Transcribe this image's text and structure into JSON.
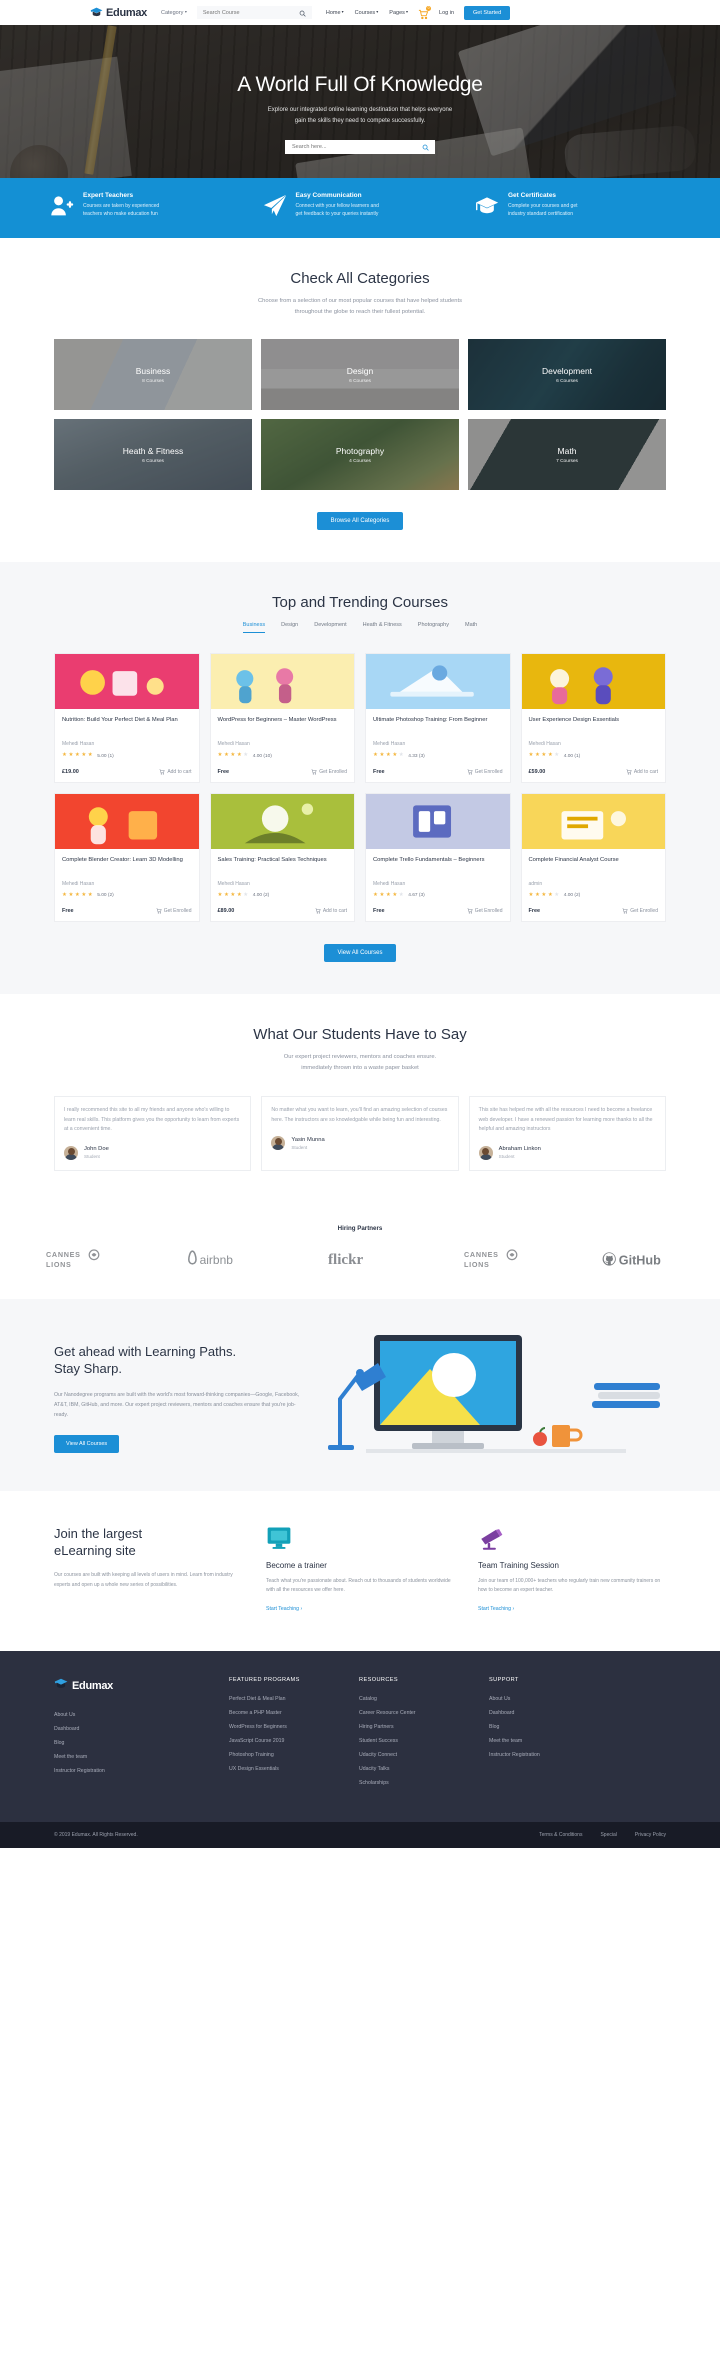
{
  "nav": {
    "brand": "Edumax",
    "category_label": "Category",
    "search_placeholder": "Search Course",
    "links": [
      {
        "label": "Home",
        "caret": true
      },
      {
        "label": "Courses",
        "caret": true
      },
      {
        "label": "Pages",
        "caret": true
      }
    ],
    "cart_count": "0",
    "login_label": "Log in",
    "cta_label": "Get Started"
  },
  "hero": {
    "title": "A World Full Of Knowledge",
    "subtitle_line1": "Explore our integrated online learning destination that helps everyone",
    "subtitle_line2": "gain the skills they need to compete successfully.",
    "search_placeholder": "Search here..."
  },
  "features": [
    {
      "icon": "user-plus-icon",
      "title": "Expert Teachers",
      "desc_line1": "Courses are taken by experienced",
      "desc_line2": "teachers who make education fun"
    },
    {
      "icon": "paper-plane-icon",
      "title": "Easy Communication",
      "desc_line1": "Connect with your fellow learners and",
      "desc_line2": "get feedback to your queries instantly"
    },
    {
      "icon": "graduation-cap-icon",
      "title": "Get Certificates",
      "desc_line1": "Complete your courses and get",
      "desc_line2": "industry standard certification"
    }
  ],
  "categories_section": {
    "title": "Check All Categories",
    "sub_line1": "Choose from a selection of our most popular courses that have helped students",
    "sub_line2": "throughout the globe to reach their fullest potential.",
    "button": "Browse All Categories",
    "items": [
      {
        "name": "Business",
        "count": "8 Courses",
        "img": "img-business"
      },
      {
        "name": "Design",
        "count": "6 Courses",
        "img": "img-design"
      },
      {
        "name": "Development",
        "count": "6 Courses",
        "img": "img-development"
      },
      {
        "name": "Heath & Fitness",
        "count": "6 Courses",
        "img": "img-fitness"
      },
      {
        "name": "Photography",
        "count": "4 Courses",
        "img": "img-photography"
      },
      {
        "name": "Math",
        "count": "7 Courses",
        "img": "img-math"
      }
    ]
  },
  "trending": {
    "title": "Top and Trending Courses",
    "tabs": [
      "Business",
      "Design",
      "Development",
      "Heath & Fitness",
      "Photography",
      "Math"
    ],
    "active_tab": "Business",
    "button": "View All Courses",
    "courses": [
      {
        "title": "Nutrition: Build Your Perfect Diet & Meal Plan",
        "author": "Mehedi Hasan",
        "stars": 5,
        "rating": "5.00",
        "reviews": "(1)",
        "price": "£19.00",
        "action": "Add to cart",
        "thumb": "#ea3d70"
      },
      {
        "title": "WordPress for Beginners – Master WordPress",
        "author": "Mehedi Hasan",
        "stars": 4,
        "rating": "4.00",
        "reviews": "(10)",
        "price": "Free",
        "action": "Get Enrolled",
        "thumb": "#fbeeb0"
      },
      {
        "title": "Ultimate Photoshop Training: From Beginner",
        "author": "Mehedi Hasan",
        "stars": 4,
        "rating": "4.33",
        "reviews": "(3)",
        "price": "Free",
        "action": "Get Enrolled",
        "thumb": "#a8d7f5"
      },
      {
        "title": "User Experience Design Essentials",
        "author": "Mehedi Hasan",
        "stars": 4,
        "rating": "4.00",
        "reviews": "(1)",
        "price": "£59.00",
        "action": "Add to cart",
        "thumb": "#e8b70e"
      },
      {
        "title": "Complete Blender Creator: Learn 3D Modelling",
        "author": "Mehedi Hasan",
        "stars": 5,
        "rating": "5.00",
        "reviews": "(2)",
        "price": "Free",
        "action": "Get Enrolled",
        "thumb": "#f2452f"
      },
      {
        "title": "Sales Training: Practical Sales Techniques",
        "author": "Mehedi Hasan",
        "stars": 4,
        "rating": "4.00",
        "reviews": "(2)",
        "price": "£89.00",
        "action": "Add to cart",
        "thumb": "#a9bf3c"
      },
      {
        "title": "Complete Trello Fundamentals – Beginners",
        "author": "Mehedi Hasan",
        "stars": 4,
        "rating": "4.67",
        "reviews": "(3)",
        "price": "Free",
        "action": "Get Enrolled",
        "thumb": "#c3c9e4"
      },
      {
        "title": "Complete Financial Analyst Course",
        "author": "admin",
        "stars": 4,
        "rating": "4.00",
        "reviews": "(2)",
        "price": "Free",
        "action": "Get Enrolled",
        "thumb": "#f8d659"
      }
    ]
  },
  "testimonials": {
    "title": "What Our Students Have to Say",
    "sub_line1": "Our expert project reviewers, mentors and coaches ensure.",
    "sub_line2": "immediately thrown into a waste paper basket",
    "items": [
      {
        "text": "I really recommend this site to all my friends and anyone who's willing to learn real skills. This platform gives you the opportunity to learn from experts at a convenient time.",
        "name": "John Doe",
        "role": "Student"
      },
      {
        "text": "No matter what you want to learn, you'll find an amazing selection of courses here. The instructors are so knowledgable while being fun and interesting.",
        "name": "Yasin Munna",
        "role": "Student"
      },
      {
        "text": "This site has helped me with all the resources I need to become a freelance web developer. I have a renewed passion for learning more thanks to all the helpful and amazing instructors",
        "name": "Abraham Linkon",
        "role": "Student"
      }
    ]
  },
  "partners": {
    "title": "Hiring Partners",
    "logos": [
      "CANNES LIONS",
      "airbnb",
      "flickr",
      "CANNES LIONS",
      "GitHub"
    ]
  },
  "learning_path": {
    "title_line1": "Get ahead with Learning Paths.",
    "title_line2": "Stay Sharp.",
    "text": "Our Nanodegree programs are built with the world's most forward-thinking companies—Google, Facebook, AT&T, IBM, GitHub, and more. Our expert project reviewers, mentors and coaches ensure that you're job-ready.",
    "button": "View All Courses"
  },
  "join": {
    "title_line1": "Join the largest",
    "title_line2": "eLearning site",
    "text": "Our courses are built with keeping all levels of users in mind. Learn from industry experts and open up a whole new series of possibilities.",
    "cards": [
      {
        "icon": "monitor-icon",
        "heading": "Become a trainer",
        "text": "Teach what you're passionate about. Reach out to thousands of students worldwide with all the resources we offer here.",
        "link": "Start Teaching ›"
      },
      {
        "icon": "telescope-icon",
        "heading": "Team Training Session",
        "text": "Join our team of 100,000+ teachers who regularly train new community trainers on how to become an expert teacher.",
        "link": "Start Teaching ›"
      }
    ]
  },
  "footer": {
    "brand": "Edumax",
    "brand_links": [
      "About Us",
      "Dashboard",
      "Blog",
      "Meet the team",
      "Instructor Registration"
    ],
    "columns": [
      {
        "heading": "FEATURED PROGRAMS",
        "links": [
          "Perfect Diet & Meal Plan",
          "Become a PHP Master",
          "WordPress for Beginners",
          "JavaScript Course 2019",
          "Photoshop Training",
          "UX Design Essentials"
        ]
      },
      {
        "heading": "RESOURCES",
        "links": [
          "Catalog",
          "Career Resource Center",
          "Hiring Partners",
          "Student Success",
          "Udacity Connect",
          "Udacity Talks",
          "Scholarships"
        ]
      },
      {
        "heading": "SUPPORT",
        "links": [
          "About Us",
          "Dashboard",
          "Blog",
          "Meet the team",
          "Instructor Registration"
        ]
      }
    ],
    "copyright": "© 2019 Edumax. All Rights Reserved.",
    "bottom_links": [
      "Terms & Conditions",
      "Special",
      "Privacy Policy"
    ]
  },
  "colors": {
    "primary": "#1c8fd6",
    "feature_bar": "#1490d4",
    "footer_bg": "#2c3040",
    "copy_bg": "#181b26",
    "star": "#f4b740"
  }
}
